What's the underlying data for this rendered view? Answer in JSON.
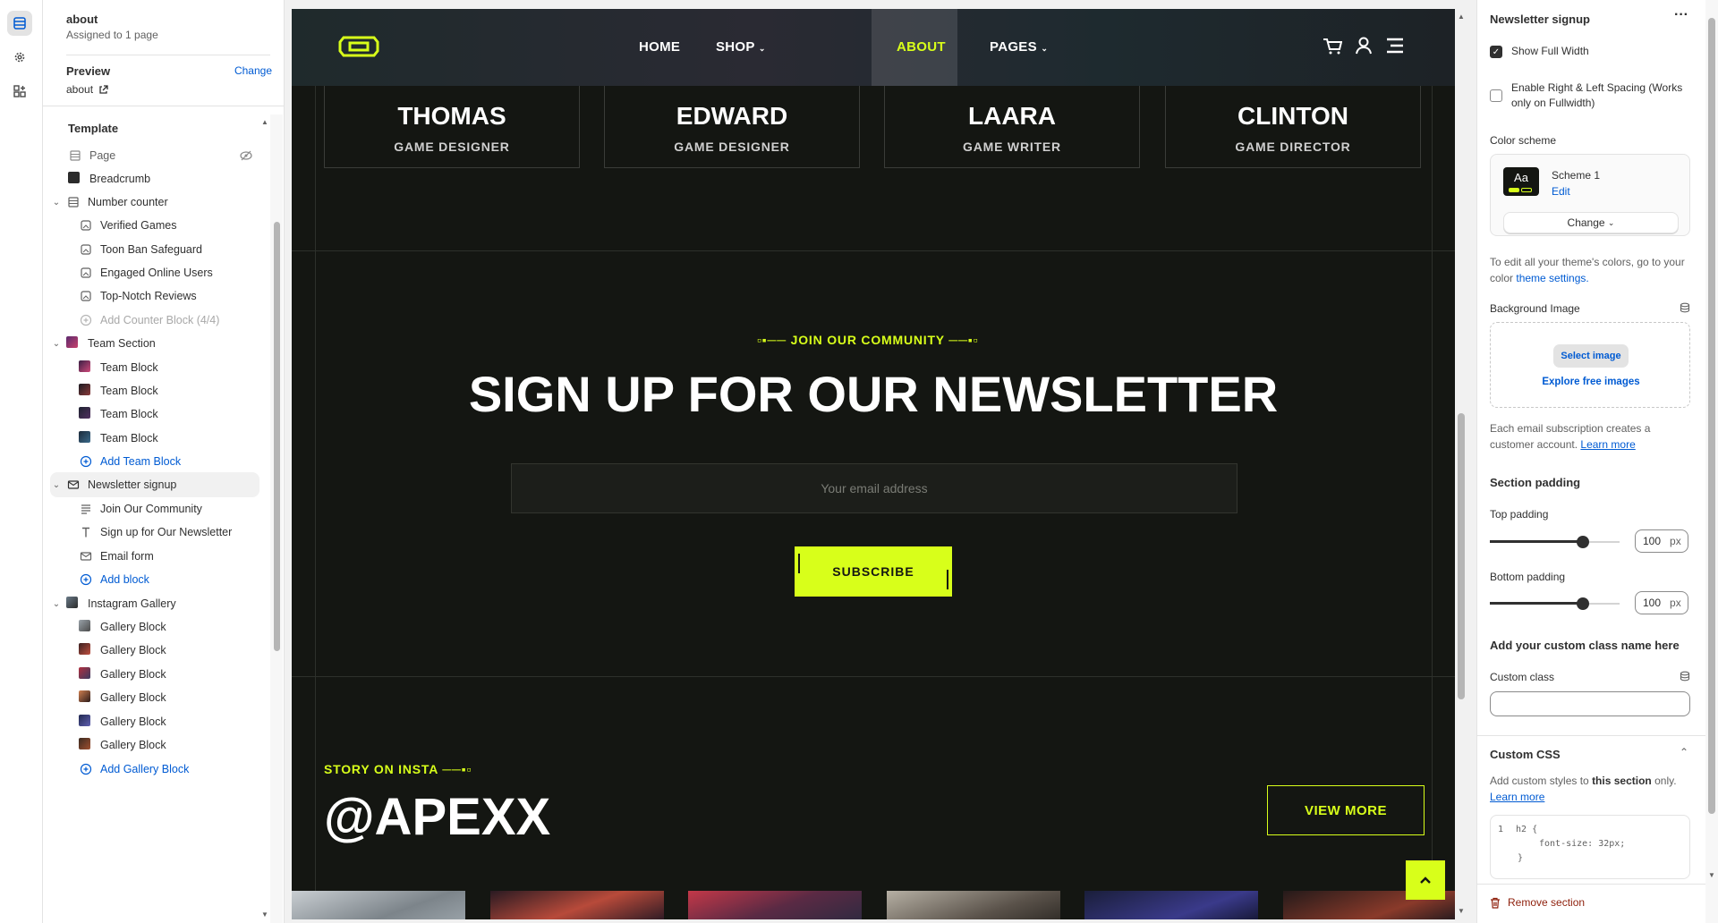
{
  "sidebar": {
    "page_name": "about",
    "page_assigned": "Assigned to 1 page",
    "preview_label": "Preview",
    "preview_change": "Change",
    "preview_value": "about",
    "template_title": "Template",
    "tree": [
      {
        "label": "Page",
        "icon": "page-icon"
      },
      {
        "label": "Breadcrumb",
        "icon": "image-thumb-icon"
      },
      {
        "label": "Number counter",
        "icon": "section-icon"
      },
      {
        "label": "Verified Games",
        "icon": "block-icon"
      },
      {
        "label": "Toon Ban Safeguard",
        "icon": "block-icon"
      },
      {
        "label": "Engaged Online Users",
        "icon": "block-icon"
      },
      {
        "label": "Top-Notch Reviews",
        "icon": "block-icon"
      },
      {
        "label": "Add Counter Block (4/4)",
        "icon": "plus-circle-icon"
      },
      {
        "label": "Team Section",
        "icon": "image-thumb-icon"
      },
      {
        "label": "Team Block",
        "icon": "image-thumb-icon"
      },
      {
        "label": "Team Block",
        "icon": "image-thumb-icon"
      },
      {
        "label": "Team Block",
        "icon": "image-thumb-icon"
      },
      {
        "label": "Team Block",
        "icon": "image-thumb-icon"
      },
      {
        "label": "Add Team Block",
        "icon": "plus-circle-icon"
      },
      {
        "label": "Newsletter signup",
        "icon": "email-icon"
      },
      {
        "label": "Join Our Community",
        "icon": "text-lines-icon"
      },
      {
        "label": "Sign up for Our Newsletter",
        "icon": "heading-icon"
      },
      {
        "label": "Email form",
        "icon": "email-icon"
      },
      {
        "label": "Add block",
        "icon": "plus-circle-icon"
      },
      {
        "label": "Instagram Gallery",
        "icon": "image-thumb-icon"
      },
      {
        "label": "Gallery Block",
        "icon": "image-thumb-icon"
      },
      {
        "label": "Gallery Block",
        "icon": "image-thumb-icon"
      },
      {
        "label": "Gallery Block",
        "icon": "image-thumb-icon"
      },
      {
        "label": "Gallery Block",
        "icon": "image-thumb-icon"
      },
      {
        "label": "Gallery Block",
        "icon": "image-thumb-icon"
      },
      {
        "label": "Gallery Block",
        "icon": "image-thumb-icon"
      },
      {
        "label": "Add Gallery Block",
        "icon": "plus-circle-icon"
      }
    ]
  },
  "preview": {
    "nav": [
      "HOME",
      "SHOP",
      "ABOUT",
      "PAGES"
    ],
    "team": [
      {
        "name": "THOMAS",
        "role": "GAME DESIGNER"
      },
      {
        "name": "EDWARD",
        "role": "GAME DESIGNER"
      },
      {
        "name": "LAARA",
        "role": "GAME WRITER"
      },
      {
        "name": "CLINTON",
        "role": "GAME DIRECTOR"
      }
    ],
    "eyebrow": "JOIN OUR COMMUNITY",
    "title": "SIGN UP FOR OUR NEWSLETTER",
    "email_placeholder": "Your email address",
    "subscribe": "SUBSCRIBE",
    "insta_eyebrow": "STORY ON INSTA",
    "insta_handle": "@APEXX",
    "view_more": "VIEW MORE",
    "accent": "#d8ff1a",
    "bg": "#141612"
  },
  "settings": {
    "title": "Newsletter signup",
    "show_full_width": "Show Full Width",
    "enable_spacing": "Enable Right & Left Spacing (Works only on Fullwidth)",
    "color_scheme_label": "Color scheme",
    "scheme_swatch": "Aa",
    "scheme_name": "Scheme 1",
    "scheme_edit": "Edit",
    "scheme_change": "Change",
    "theme_note_pre": "To edit all your theme's colors, go to your color",
    "theme_note_link": "theme settings.",
    "bg_image_label": "Background Image",
    "select_image": "Select image",
    "explore_images": "Explore free images",
    "email_note": "Each email subscription creates a customer account.",
    "learn_more": "Learn more",
    "section_padding": "Section padding",
    "top_padding_label": "Top padding",
    "top_padding": "100",
    "top_padding_value": 100,
    "bottom_padding_label": "Bottom padding",
    "bottom_padding": "100",
    "bottom_padding_value": 100,
    "unit": "px",
    "custom_class_heading": "Add your custom class name here",
    "custom_class_label": "Custom class",
    "custom_css_heading": "Custom CSS",
    "custom_css_note_pre": "Add custom styles to",
    "custom_css_note_bold": "this section",
    "custom_css_note_post": "only.",
    "custom_css_learn": "Learn more",
    "css_line_no": "1",
    "css_l1": "h2 {",
    "css_l2": "font-size: 32px;",
    "css_l3": "}",
    "remove_section": "Remove section"
  }
}
